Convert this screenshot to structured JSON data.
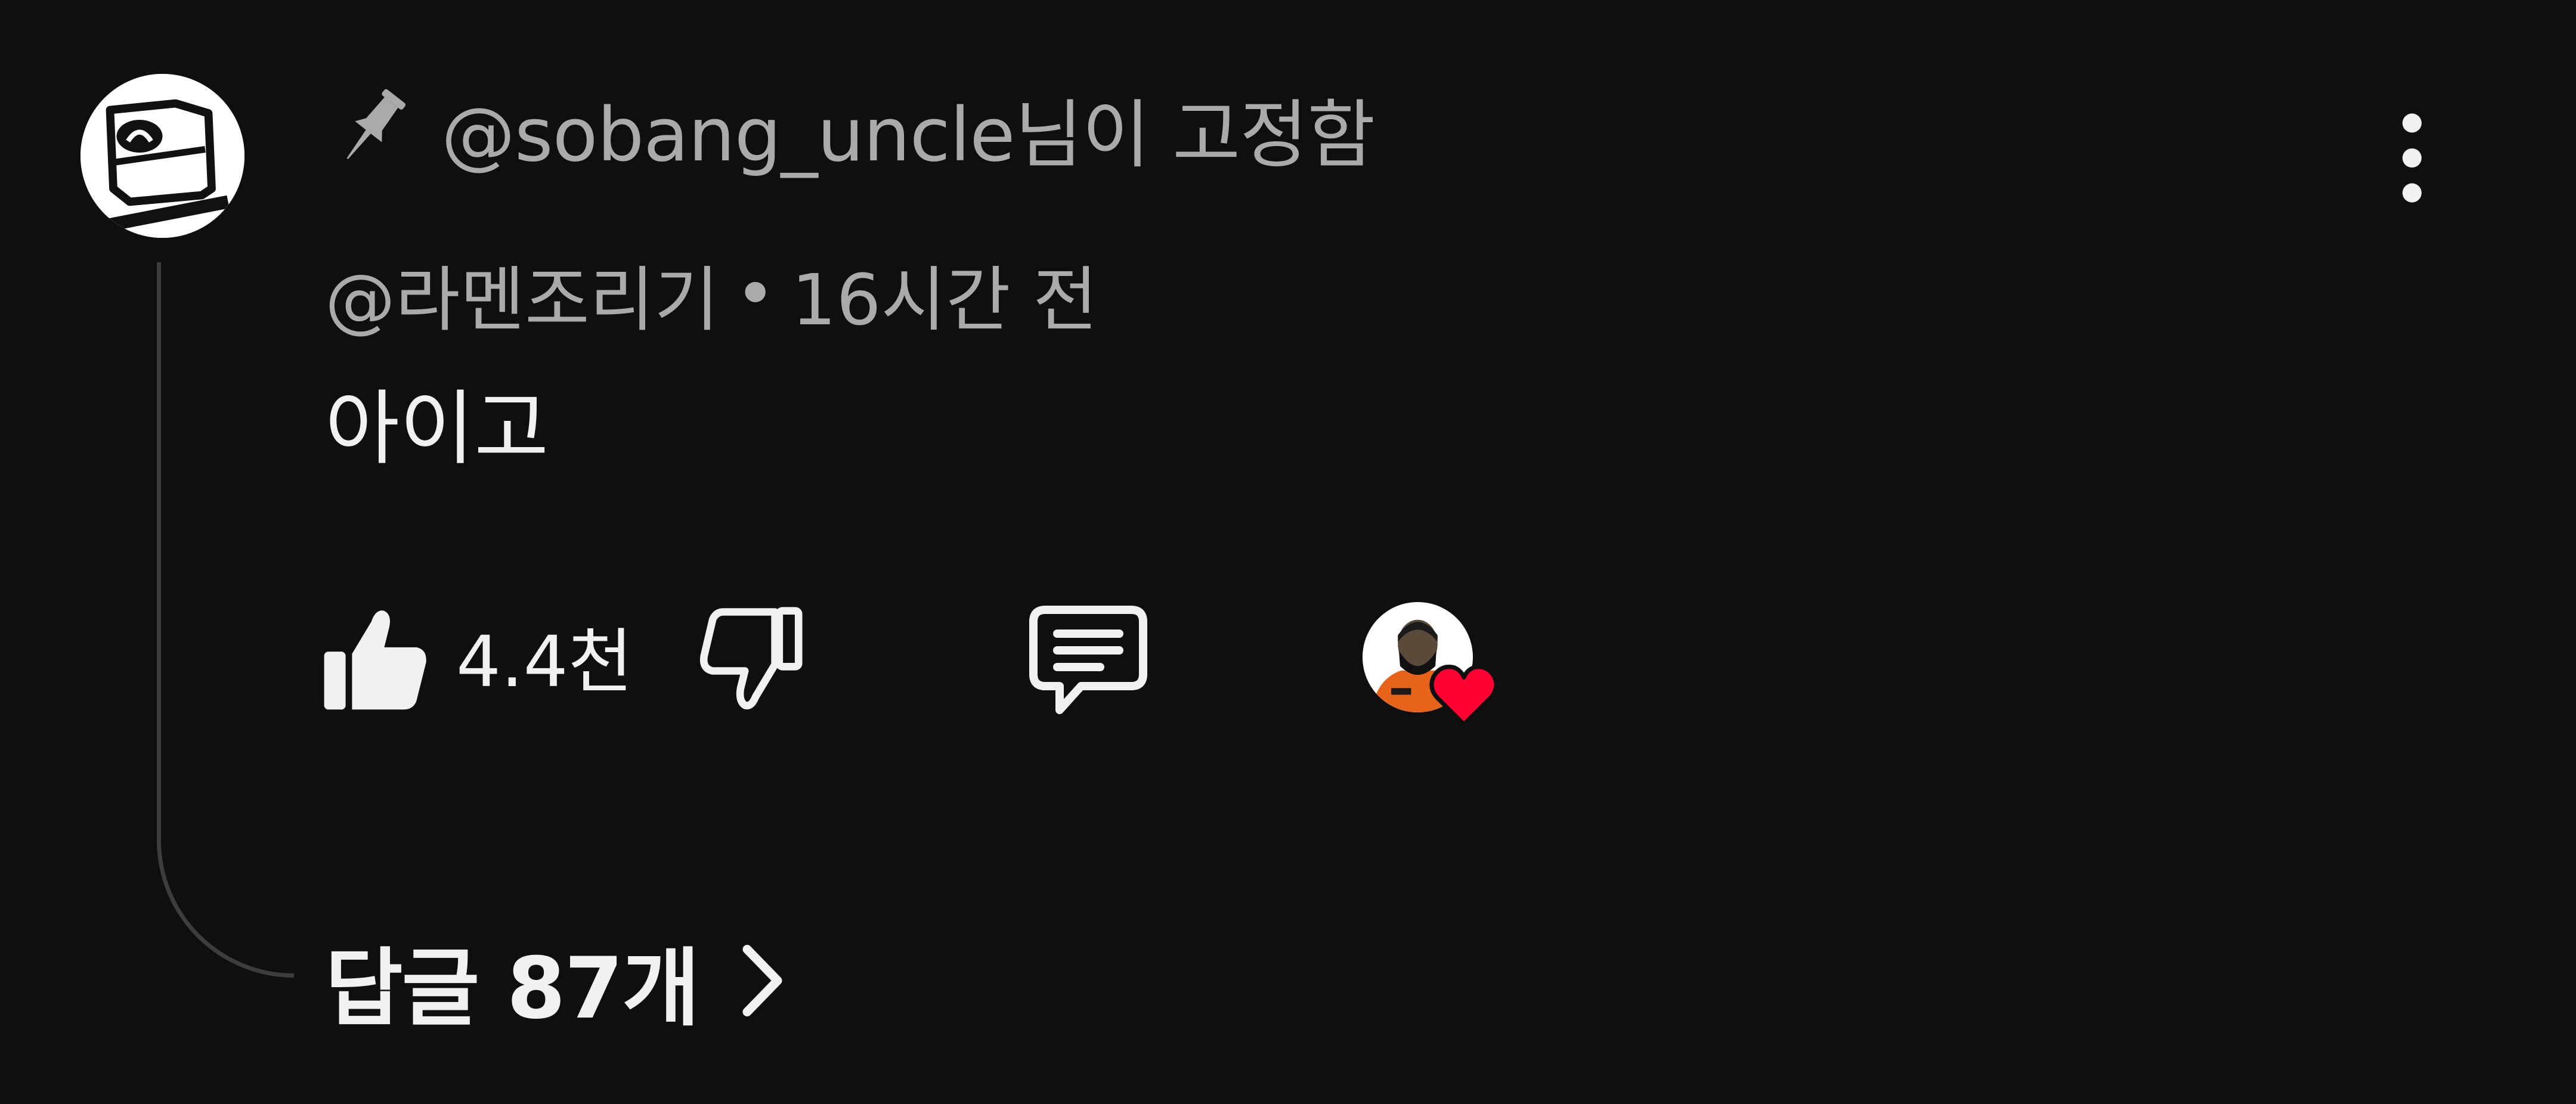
{
  "pinned": {
    "text": "@sobang_uncle님이 고정함",
    "icon": "pin-icon"
  },
  "comment": {
    "author": "@라멘조리기",
    "separator": "•",
    "time": "16시간 전",
    "body": "아이고"
  },
  "actions": {
    "like_count": "4.4천",
    "like_icon": "thumbs-up-icon",
    "dislike_icon": "thumbs-down-icon",
    "reply_icon": "comment-icon",
    "creator_heart_icon": "heart-icon"
  },
  "replies": {
    "label": "답글 87개",
    "icon": "chevron-right-icon"
  },
  "colors": {
    "background": "#0f0f0f",
    "primary_text": "#f1f1f1",
    "secondary_text": "#aaaaaa",
    "heart": "#ff0033",
    "creator_shirt": "#e8631a"
  }
}
